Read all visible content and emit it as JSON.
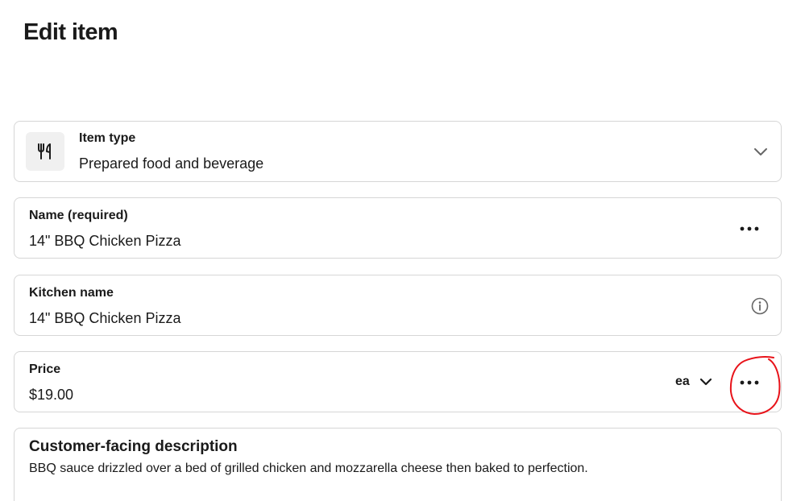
{
  "page": {
    "title": "Edit item"
  },
  "item_type": {
    "label": "Item type",
    "value": "Prepared food and beverage",
    "icon": "fork-knife-icon"
  },
  "name": {
    "label": "Name (required)",
    "value": "14\" BBQ Chicken Pizza"
  },
  "kitchen_name": {
    "label": "Kitchen name",
    "value": "14\" BBQ Chicken Pizza"
  },
  "price": {
    "label": "Price",
    "value": "$19.00",
    "unit": "ea"
  },
  "description": {
    "label": "Customer-facing description",
    "value": "BBQ sauce drizzled over a bed of grilled chicken and mozzarella cheese then baked to perfection."
  },
  "annotation": {
    "color": "#e8131a",
    "shape": "hand-drawn circle around price more-options button"
  }
}
